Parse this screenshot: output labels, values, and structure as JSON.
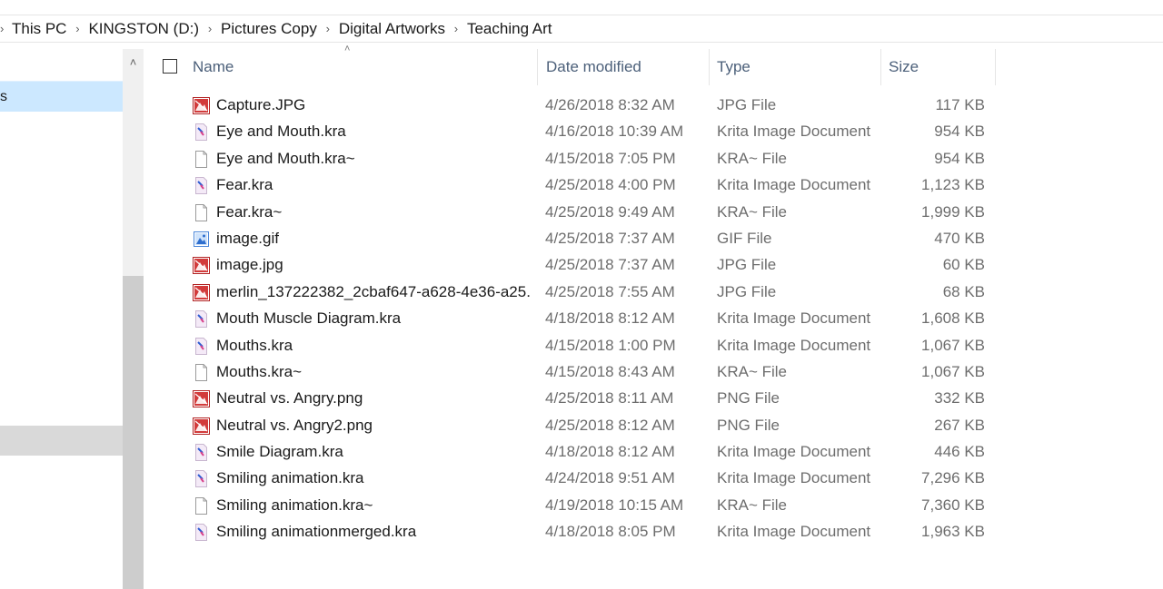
{
  "breadcrumb": {
    "items": [
      "This PC",
      "KINGSTON (D:)",
      "Pictures Copy",
      "Digital Artworks",
      "Teaching Art"
    ]
  },
  "nav": {
    "selected_label": "s"
  },
  "columns": {
    "name": "Name",
    "date": "Date modified",
    "type": "Type",
    "size": "Size"
  },
  "files": [
    {
      "icon": "jpg-image-icon",
      "name": "Capture.JPG",
      "date": "4/26/2018 8:32 AM",
      "type": "JPG File",
      "size": "117 KB"
    },
    {
      "icon": "krita-file-icon",
      "name": "Eye and Mouth.kra",
      "date": "4/16/2018 10:39 AM",
      "type": "Krita Image Document",
      "size": "954 KB"
    },
    {
      "icon": "blank-file-icon",
      "name": "Eye and Mouth.kra~",
      "date": "4/15/2018 7:05 PM",
      "type": "KRA~ File",
      "size": "954 KB"
    },
    {
      "icon": "krita-file-icon",
      "name": "Fear.kra",
      "date": "4/25/2018 4:00 PM",
      "type": "Krita Image Document",
      "size": "1,123 KB"
    },
    {
      "icon": "blank-file-icon",
      "name": "Fear.kra~",
      "date": "4/25/2018 9:49 AM",
      "type": "KRA~ File",
      "size": "1,999 KB"
    },
    {
      "icon": "gif-image-icon",
      "name": "image.gif",
      "date": "4/25/2018 7:37 AM",
      "type": "GIF File",
      "size": "470 KB"
    },
    {
      "icon": "jpg-image-icon",
      "name": "image.jpg",
      "date": "4/25/2018 7:37 AM",
      "type": "JPG File",
      "size": "60 KB"
    },
    {
      "icon": "jpg-image-icon",
      "name": "merlin_137222382_2cbaf647-a628-4e36-a25...",
      "date": "4/25/2018 7:55 AM",
      "type": "JPG File",
      "size": "68 KB"
    },
    {
      "icon": "krita-file-icon",
      "name": "Mouth Muscle Diagram.kra",
      "date": "4/18/2018 8:12 AM",
      "type": "Krita Image Document",
      "size": "1,608 KB"
    },
    {
      "icon": "krita-file-icon",
      "name": "Mouths.kra",
      "date": "4/15/2018 1:00 PM",
      "type": "Krita Image Document",
      "size": "1,067 KB"
    },
    {
      "icon": "blank-file-icon",
      "name": "Mouths.kra~",
      "date": "4/15/2018 8:43 AM",
      "type": "KRA~ File",
      "size": "1,067 KB"
    },
    {
      "icon": "jpg-image-icon",
      "name": "Neutral vs. Angry.png",
      "date": "4/25/2018 8:11 AM",
      "type": "PNG File",
      "size": "332 KB"
    },
    {
      "icon": "jpg-image-icon",
      "name": "Neutral vs. Angry2.png",
      "date": "4/25/2018 8:12 AM",
      "type": "PNG File",
      "size": "267 KB"
    },
    {
      "icon": "krita-file-icon",
      "name": "Smile Diagram.kra",
      "date": "4/18/2018 8:12 AM",
      "type": "Krita Image Document",
      "size": "446 KB"
    },
    {
      "icon": "krita-file-icon",
      "name": "Smiling animation.kra",
      "date": "4/24/2018 9:51 AM",
      "type": "Krita Image Document",
      "size": "7,296 KB"
    },
    {
      "icon": "blank-file-icon",
      "name": "Smiling animation.kra~",
      "date": "4/19/2018 10:15 AM",
      "type": "KRA~ File",
      "size": "7,360 KB"
    },
    {
      "icon": "krita-file-icon",
      "name": "Smiling animationmerged.kra",
      "date": "4/18/2018 8:05 PM",
      "type": "Krita Image Document",
      "size": "1,963 KB"
    }
  ]
}
